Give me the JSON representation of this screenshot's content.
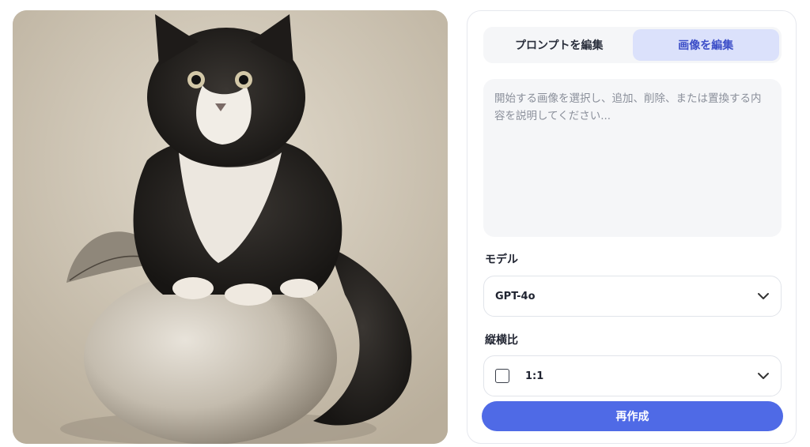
{
  "tabs": [
    {
      "label": "プロンプトを編集",
      "active": false
    },
    {
      "label": "画像を編集",
      "active": true
    }
  ],
  "prompt": {
    "placeholder": "開始する画像を選択し、追加、削除、または置換する内容を説明してください...",
    "value": ""
  },
  "model": {
    "label": "モデル",
    "selected": "GPT-4o",
    "icon": "chevron-down-icon"
  },
  "aspect": {
    "label": "縦横比",
    "selected": "1:1",
    "icon": "chevron-down-icon"
  },
  "regenerate_label": "再作成",
  "colors": {
    "accent": "#4f6ae6",
    "active_tab_bg": "#dbe1fb",
    "active_tab_text": "#3d4fc8",
    "field_bg": "#f5f6f8"
  }
}
